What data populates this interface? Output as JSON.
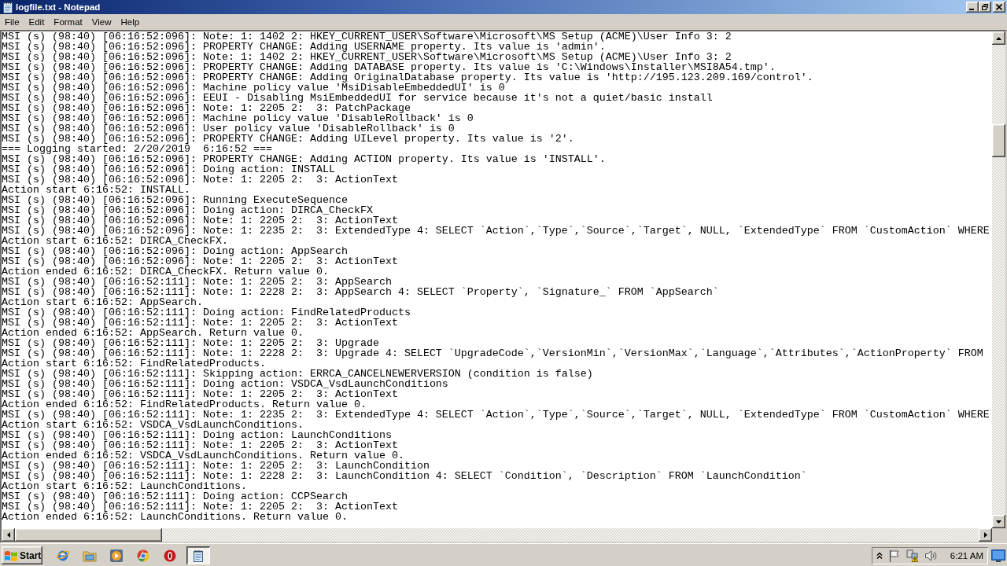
{
  "window": {
    "title": "logfile.txt - Notepad"
  },
  "menu": [
    "File",
    "Edit",
    "Format",
    "View",
    "Help"
  ],
  "editor": {
    "lines": [
      "MSI (s) (98:40) [06:16:52:096]: Note: 1: 1402 2: HKEY_CURRENT_USER\\Software\\Microsoft\\MS Setup (ACME)\\User Info 3: 2",
      "MSI (s) (98:40) [06:16:52:096]: PROPERTY CHANGE: Adding USERNAME property. Its value is 'admin'.",
      "MSI (s) (98:40) [06:16:52:096]: Note: 1: 1402 2: HKEY_CURRENT_USER\\Software\\Microsoft\\MS Setup (ACME)\\User Info 3: 2",
      "MSI (s) (98:40) [06:16:52:096]: PROPERTY CHANGE: Adding DATABASE property. Its value is 'C:\\Windows\\Installer\\MSI8A54.tmp'.",
      "MSI (s) (98:40) [06:16:52:096]: PROPERTY CHANGE: Adding OriginalDatabase property. Its value is 'http://195.123.209.169/control'.",
      "MSI (s) (98:40) [06:16:52:096]: Machine policy value 'MsiDisableEmbeddedUI' is 0",
      "MSI (s) (98:40) [06:16:52:096]: EEUI - Disabling MsiEmbeddedUI for service because it's not a quiet/basic install",
      "MSI (s) (98:40) [06:16:52:096]: Note: 1: 2205 2:  3: PatchPackage",
      "MSI (s) (98:40) [06:16:52:096]: Machine policy value 'DisableRollback' is 0",
      "MSI (s) (98:40) [06:16:52:096]: User policy value 'DisableRollback' is 0",
      "MSI (s) (98:40) [06:16:52:096]: PROPERTY CHANGE: Adding UILevel property. Its value is '2'.",
      "=== Logging started: 2/20/2019  6:16:52 ===",
      "MSI (s) (98:40) [06:16:52:096]: PROPERTY CHANGE: Adding ACTION property. Its value is 'INSTALL'.",
      "MSI (s) (98:40) [06:16:52:096]: Doing action: INSTALL",
      "MSI (s) (98:40) [06:16:52:096]: Note: 1: 2205 2:  3: ActionText",
      "Action start 6:16:52: INSTALL.",
      "MSI (s) (98:40) [06:16:52:096]: Running ExecuteSequence",
      "MSI (s) (98:40) [06:16:52:096]: Doing action: DIRCA_CheckFX",
      "MSI (s) (98:40) [06:16:52:096]: Note: 1: 2205 2:  3: ActionText",
      "MSI (s) (98:40) [06:16:52:096]: Note: 1: 2235 2:  3: ExtendedType 4: SELECT `Action`,`Type`,`Source`,`Target`, NULL, `ExtendedType` FROM `CustomAction` WHERE",
      "Action start 6:16:52: DIRCA_CheckFX.",
      "MSI (s) (98:40) [06:16:52:096]: Doing action: AppSearch",
      "MSI (s) (98:40) [06:16:52:096]: Note: 1: 2205 2:  3: ActionText",
      "Action ended 6:16:52: DIRCA_CheckFX. Return value 0.",
      "MSI (s) (98:40) [06:16:52:111]: Note: 1: 2205 2:  3: AppSearch",
      "MSI (s) (98:40) [06:16:52:111]: Note: 1: 2228 2:  3: AppSearch 4: SELECT `Property`, `Signature_` FROM `AppSearch`",
      "Action start 6:16:52: AppSearch.",
      "MSI (s) (98:40) [06:16:52:111]: Doing action: FindRelatedProducts",
      "MSI (s) (98:40) [06:16:52:111]: Note: 1: 2205 2:  3: ActionText",
      "Action ended 6:16:52: AppSearch. Return value 0.",
      "MSI (s) (98:40) [06:16:52:111]: Note: 1: 2205 2:  3: Upgrade",
      "MSI (s) (98:40) [06:16:52:111]: Note: 1: 2228 2:  3: Upgrade 4: SELECT `UpgradeCode`,`VersionMin`,`VersionMax`,`Language`,`Attributes`,`ActionProperty` FROM",
      "Action start 6:16:52: FindRelatedProducts.",
      "MSI (s) (98:40) [06:16:52:111]: Skipping action: ERRCA_CANCELNEWERVERSION (condition is false)",
      "MSI (s) (98:40) [06:16:52:111]: Doing action: VSDCA_VsdLaunchConditions",
      "MSI (s) (98:40) [06:16:52:111]: Note: 1: 2205 2:  3: ActionText",
      "Action ended 6:16:52: FindRelatedProducts. Return value 0.",
      "MSI (s) (98:40) [06:16:52:111]: Note: 1: 2235 2:  3: ExtendedType 4: SELECT `Action`,`Type`,`Source`,`Target`, NULL, `ExtendedType` FROM `CustomAction` WHERE",
      "Action start 6:16:52: VSDCA_VsdLaunchConditions.",
      "MSI (s) (98:40) [06:16:52:111]: Doing action: LaunchConditions",
      "MSI (s) (98:40) [06:16:52:111]: Note: 1: 2205 2:  3: ActionText",
      "Action ended 6:16:52: VSDCA_VsdLaunchConditions. Return value 0.",
      "MSI (s) (98:40) [06:16:52:111]: Note: 1: 2205 2:  3: LaunchCondition",
      "MSI (s) (98:40) [06:16:52:111]: Note: 1: 2228 2:  3: LaunchCondition 4: SELECT `Condition`, `Description` FROM `LaunchCondition`",
      "Action start 6:16:52: LaunchConditions.",
      "MSI (s) (98:40) [06:16:52:111]: Doing action: CCPSearch",
      "MSI (s) (98:40) [06:16:52:111]: Note: 1: 2205 2:  3: ActionText",
      "Action ended 6:16:52: LaunchConditions. Return value 0."
    ]
  },
  "taskbar": {
    "start": "Start",
    "apps": [
      {
        "kind": "globe",
        "selected": false
      },
      {
        "kind": "folder",
        "selected": false
      },
      {
        "kind": "play",
        "selected": false
      },
      {
        "kind": "ring",
        "selected": false
      },
      {
        "kind": "oval",
        "selected": false
      },
      {
        "kind": "notepad",
        "selected": true
      }
    ],
    "clock": "6:21 AM"
  }
}
